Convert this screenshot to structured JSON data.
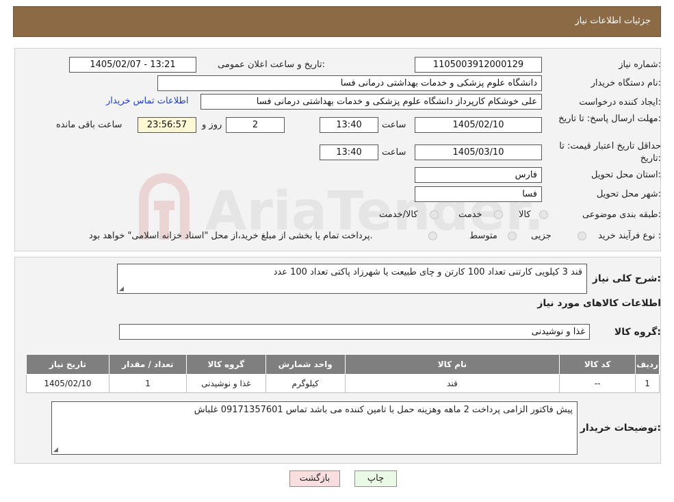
{
  "header": {
    "title": "جزئیات اطلاعات نیاز"
  },
  "watermark": {
    "text": "AriaTender.neT"
  },
  "form": {
    "need_number": {
      "label": "شماره نیاز:",
      "value": "1105003912000129"
    },
    "announce": {
      "label": "تاریخ و ساعت اعلان عمومی:",
      "value": "1405/02/07 - 13:21"
    },
    "buyer_org": {
      "label": "نام دستگاه خریدار:",
      "value": "دانشگاه علوم پزشکی و خدمات بهداشتی درمانی فسا"
    },
    "creator": {
      "label": "ایجاد کننده درخواست:",
      "value": "علی خوشکام کارپرداز دانشگاه علوم پزشکی و خدمات بهداشتی درمانی فسا",
      "contact_link": "اطلاعات تماس خریدار"
    },
    "deadline": {
      "label": "مهلت ارسال پاسخ: تا تاریخ:",
      "date": "1405/02/10",
      "time_label": "ساعت",
      "time": "13:40",
      "days": "2",
      "days_label": "روز و",
      "remaining": "23:56:57",
      "remaining_label": "ساعت باقی مانده"
    },
    "validity": {
      "label": "حداقل تاریخ اعتبار قیمت: تا تاریخ:",
      "date": "1405/03/10",
      "time_label": "ساعت",
      "time": "13:40"
    },
    "province": {
      "label": "استان محل تحویل:",
      "value": "فارس"
    },
    "city": {
      "label": "شهر محل تحویل:",
      "value": "فسا"
    },
    "category": {
      "label": "طبقه بندی موضوعی:",
      "options": [
        "کالا",
        "خدمت",
        "کالا/خدمت"
      ]
    },
    "purchase_type": {
      "label": "نوع فرآیند خرید :",
      "options": [
        "جزیی",
        "متوسط"
      ],
      "note": "پرداخت تمام یا بخشی از مبلغ خرید،از محل \"اسناد خزانه اسلامی\" خواهد بود."
    }
  },
  "details": {
    "summary_label": "شرح کلی نیاز:",
    "summary": "قند 3 کیلویی کارتنی تعداد 100 کارتن و چای طبیعت یا شهرزاد پاکتی تعداد 100 عدد",
    "goods_title": "اطلاعات کالاهای مورد نیاز",
    "group_label": "گروه کالا:",
    "group_value": "غذا و نوشیدنی",
    "table": {
      "headers": [
        "ردیف",
        "کد کالا",
        "نام کالا",
        "واحد شمارش",
        "گروه کالا",
        "تعداد / مقدار",
        "تاریخ نیاز"
      ],
      "rows": [
        [
          "1",
          "--",
          "قند",
          "کیلوگرم",
          "غذا و نوشیدنی",
          "1",
          "1405/02/10"
        ]
      ]
    },
    "buyer_notes_label": "توضیحات خریدار:",
    "buyer_notes": "پیش فاکتور الزامی پرداخت 2 ماهه وهزینه حمل با تامین کننده می باشد تماس 09171357601 غلباش"
  },
  "buttons": {
    "print": "چاپ",
    "back": "بازگشت"
  },
  "colors": {
    "header": "#8b6a45",
    "link": "#1a3fc7",
    "table_header": "#7f7f7f",
    "back_button": "#f8dede",
    "print_button": "#eaf8e6"
  }
}
